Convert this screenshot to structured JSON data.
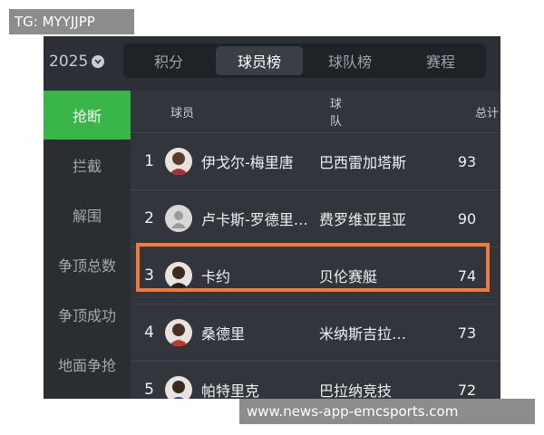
{
  "watermark_top": "TG: MYYJJPP",
  "watermark_bottom": "www.news-app-emcsports.com",
  "year": "2025",
  "tabs": [
    "积分",
    "球员榜",
    "球队榜",
    "赛程"
  ],
  "active_tab": "球员榜",
  "sidebar": [
    "抢断",
    "拦截",
    "解围",
    "争顶总数",
    "争顶成功",
    "地面争抢"
  ],
  "active_sidebar": "抢断",
  "table": {
    "headers": {
      "player": "球员",
      "team": "球队",
      "total": "总计"
    },
    "rows": [
      {
        "rank": "1",
        "player": "伊戈尔-梅里唐",
        "team": "巴西雷加塔斯",
        "total": "93",
        "avatar": "player-photo"
      },
      {
        "rank": "2",
        "player": "卢卡斯-罗德里…",
        "team": "费罗维亚里亚",
        "total": "90",
        "avatar": "placeholder-avatar"
      },
      {
        "rank": "3",
        "player": "卡约",
        "team": "贝伦赛艇",
        "total": "74",
        "avatar": "player-photo",
        "highlighted": true
      },
      {
        "rank": "4",
        "player": "桑德里",
        "team": "米纳斯吉拉…",
        "total": "73",
        "avatar": "player-photo"
      },
      {
        "rank": "5",
        "player": "帕特里克",
        "team": "巴拉纳竞技",
        "total": "72",
        "avatar": "player-photo"
      }
    ]
  },
  "colors": {
    "accent_green": "#39b54a",
    "highlight_orange": "#f07a3c",
    "background": "#2c3036"
  }
}
